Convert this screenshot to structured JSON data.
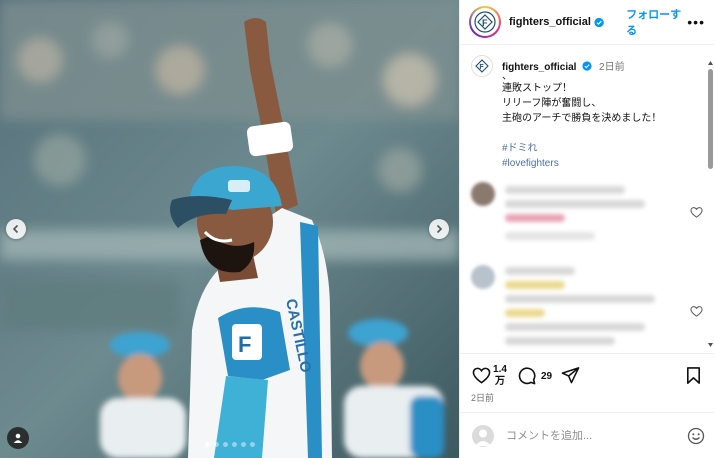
{
  "account": {
    "username": "fighters_official",
    "follow_label": "フォローする",
    "more_label": "•••"
  },
  "caption": {
    "username": "fighters_official",
    "time": "2日前",
    "lines": [
      "、",
      "連敗ストップ！",
      "リリーフ陣が奮闘し、",
      "主砲のアーチで勝負を決めました！"
    ],
    "hashtags": [
      "#ドミれ",
      "#lovefighters"
    ]
  },
  "stats": {
    "likes": "1.4万",
    "likes_top": "1.4",
    "likes_bottom": "万",
    "comments": "29"
  },
  "post_date": "2日前",
  "comment_box": {
    "placeholder": "コメントを追加..."
  },
  "carousel": {
    "total": 6,
    "current": 1
  },
  "colors": {
    "accent": "#0095f6",
    "verified": "#0095f6",
    "hashtag": "#4a6fa5",
    "cap_blue": "#3ba6d0"
  },
  "icons": {
    "prev": "chevron-left-icon",
    "next": "chevron-right-icon",
    "like": "heart-icon",
    "comment": "speech-bubble-icon",
    "share": "paper-plane-icon",
    "save": "bookmark-icon",
    "emoji": "smiley-icon",
    "tag": "person-icon"
  }
}
